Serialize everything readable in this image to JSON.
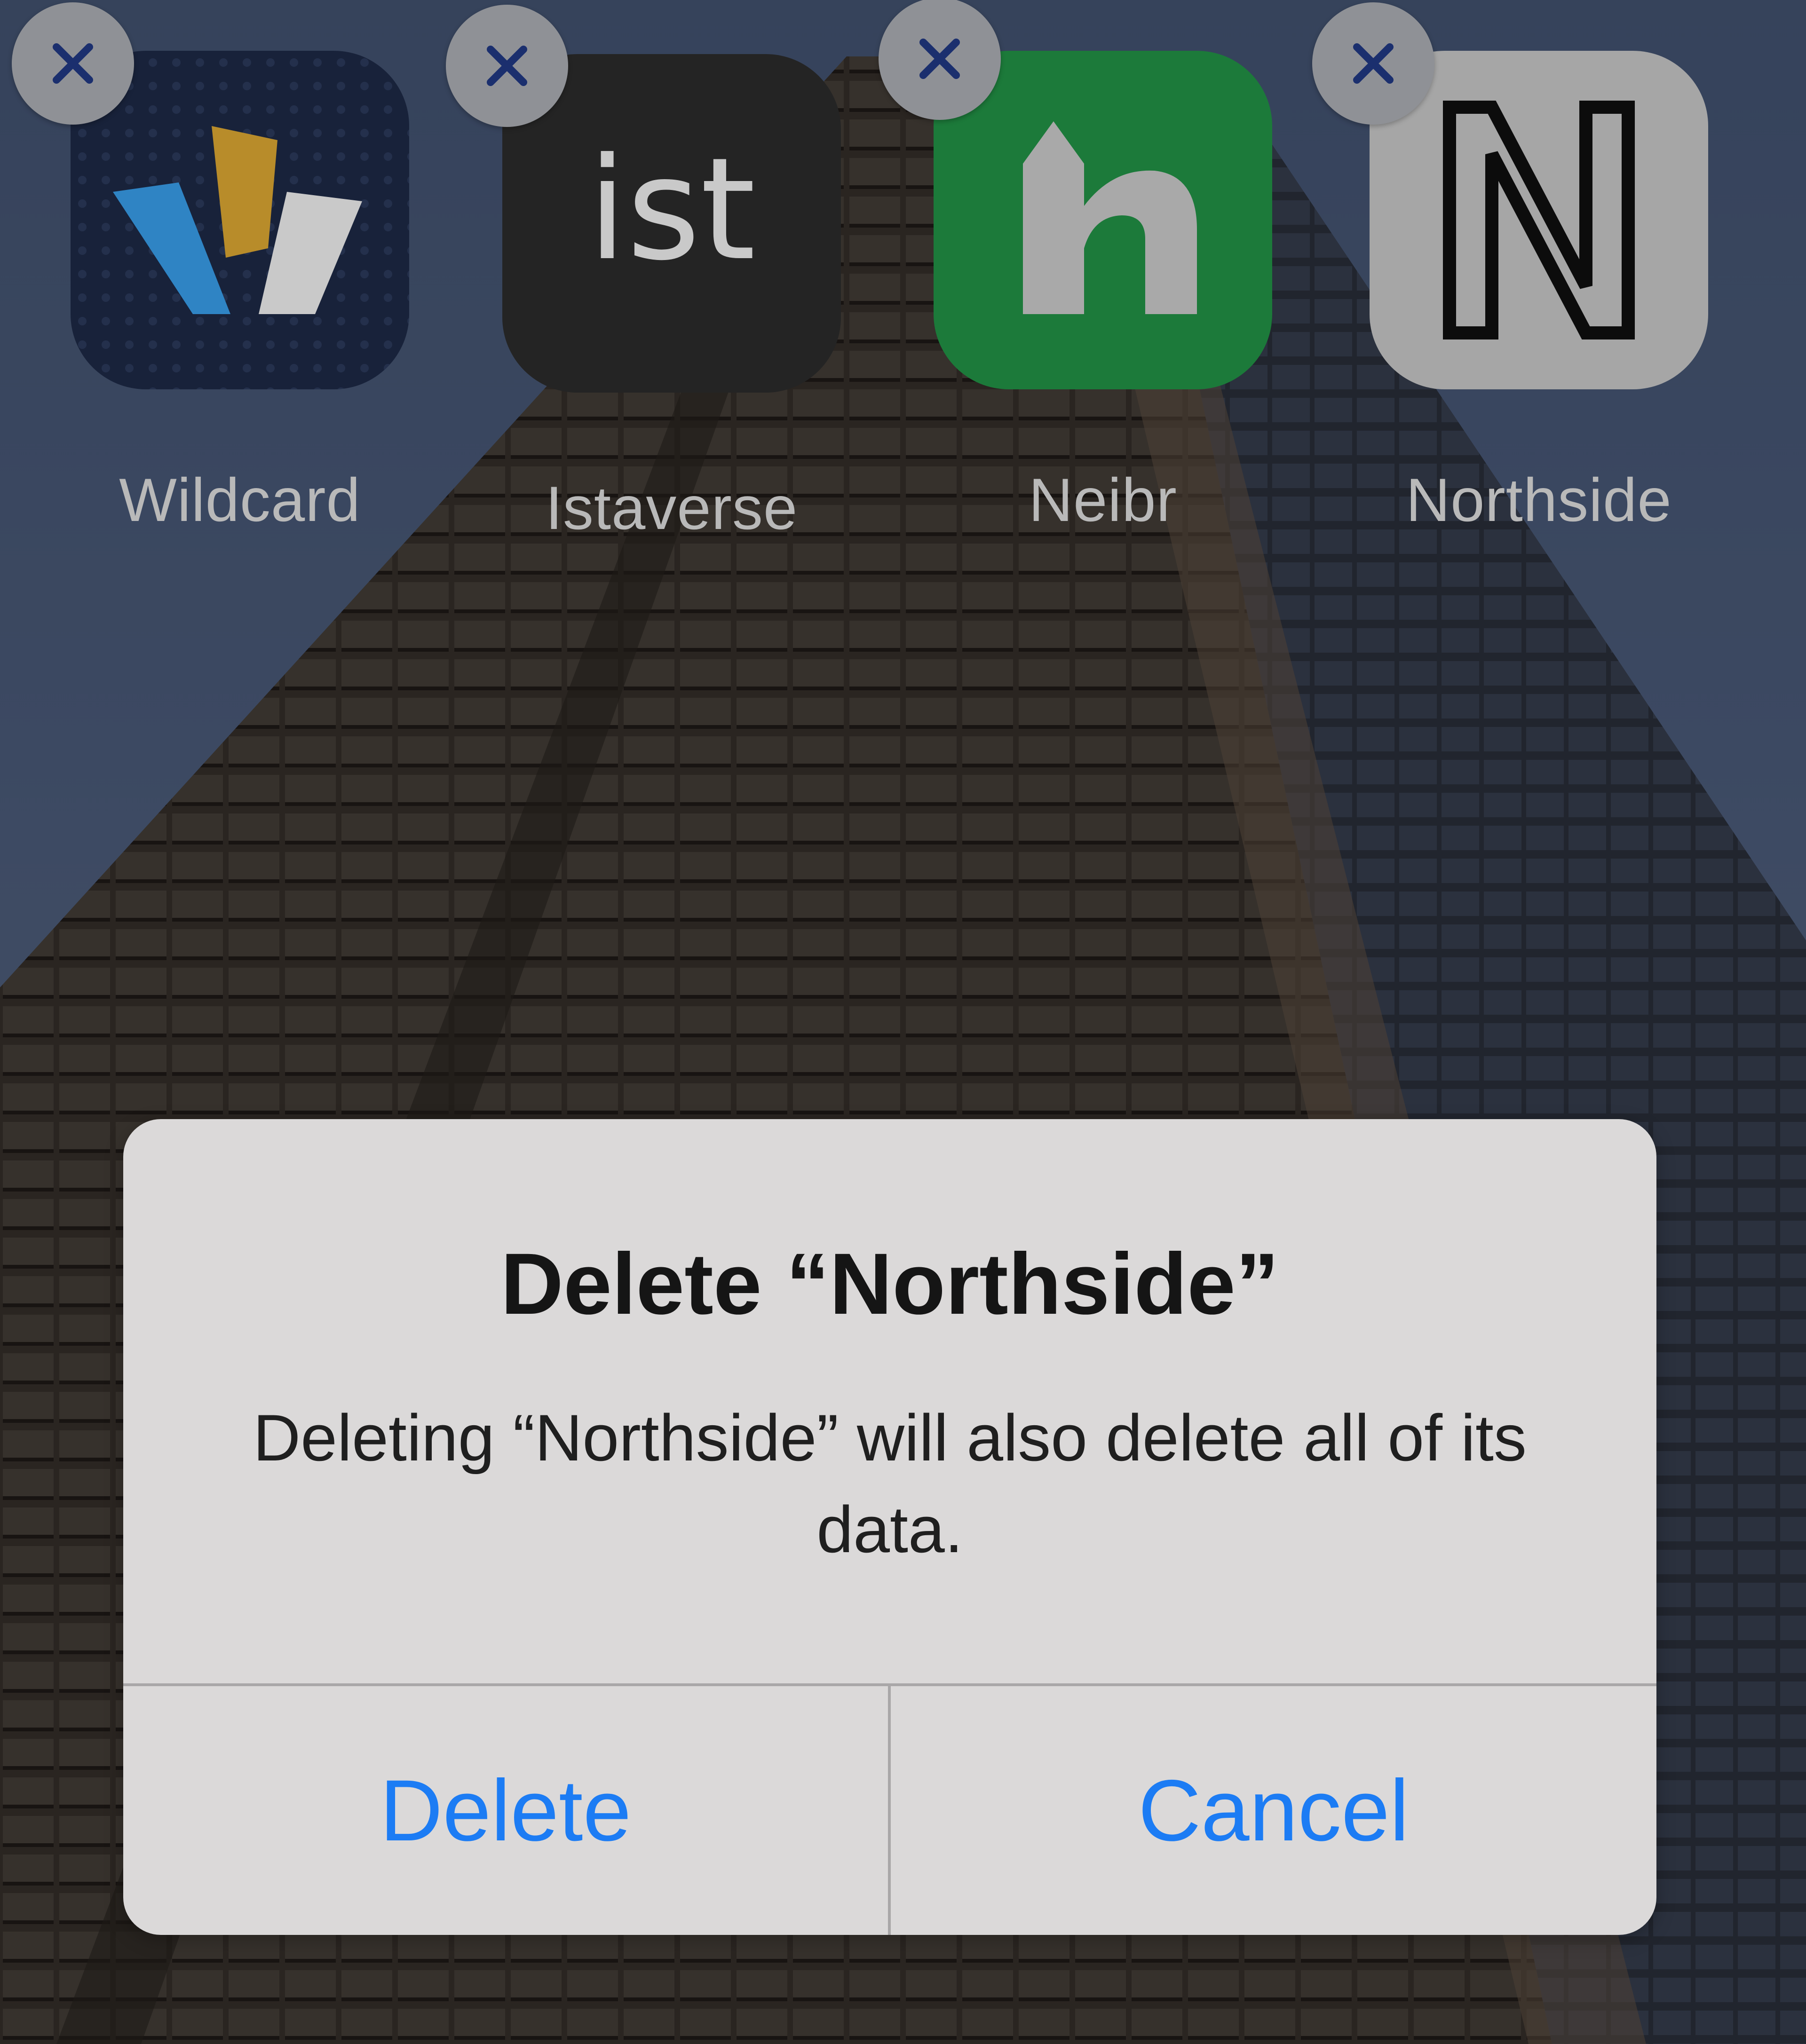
{
  "apps": [
    {
      "label": "Wildcard",
      "icon": "wildcard-logo-icon",
      "tile_color": "#18223a"
    },
    {
      "label": "Istaverse",
      "icon": "istaverse-logo-icon",
      "tile_color": "#242424",
      "logo_text": "ist"
    },
    {
      "label": "Neibr",
      "icon": "neibr-logo-icon",
      "tile_color": "#1c7a3a"
    },
    {
      "label": "Northside",
      "icon": "northside-logo-icon",
      "tile_color": "#a6a6a6"
    }
  ],
  "delete_badge_icon": "close-icon",
  "alert": {
    "title": "Delete “Northside”",
    "message": "Deleting “Northside” will also delete all of its data.",
    "delete_label": "Delete",
    "cancel_label": "Cancel"
  },
  "colors": {
    "accent": "#1c7cf4",
    "alert_bg": "#dbd9d9",
    "badge_x": "#1b2f6e"
  }
}
